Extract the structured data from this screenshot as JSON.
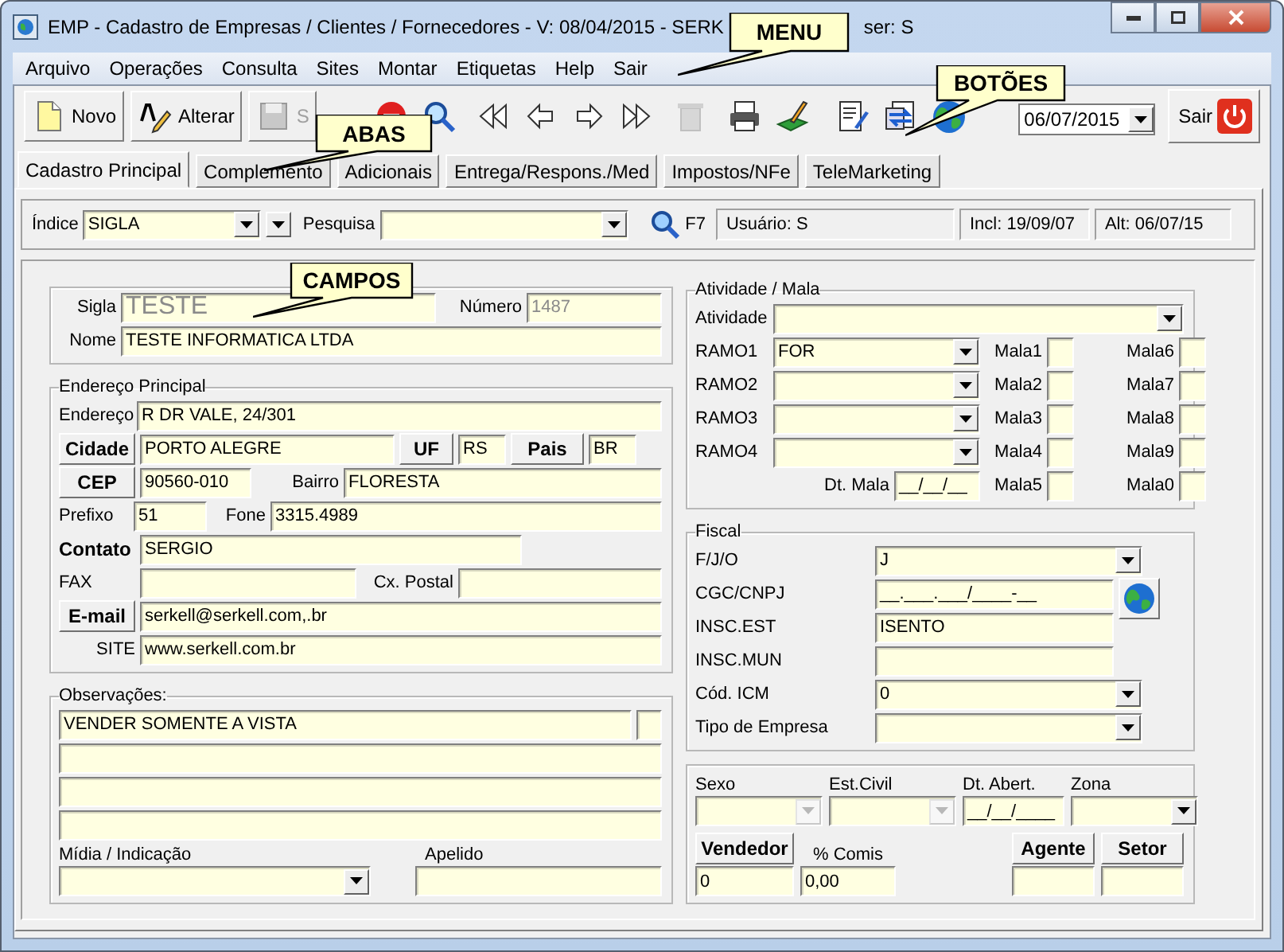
{
  "window": {
    "title": "EMP - Cadastro de Empresas / Clientes / Fornecedores - V: 08/04/2015 - SERK",
    "title_tail": "ser: S"
  },
  "menu": [
    "Arquivo",
    "Operações",
    "Consulta",
    "Sites",
    "Montar",
    "Etiquetas",
    "Help",
    "Sair"
  ],
  "toolbar": [
    {
      "kind": "new",
      "label": "Novo",
      "disabled": false
    },
    {
      "kind": "edit",
      "label": "Alterar",
      "disabled": false
    },
    {
      "kind": "save",
      "label": "S",
      "disabled": true
    },
    {
      "kind": "stop",
      "disabled": false
    },
    {
      "kind": "search",
      "disabled": false
    },
    {
      "kind": "first",
      "disabled": false
    },
    {
      "kind": "prev",
      "disabled": false
    },
    {
      "kind": "next",
      "disabled": false
    },
    {
      "kind": "last",
      "disabled": false
    },
    {
      "kind": "delete",
      "disabled": true
    },
    {
      "kind": "print",
      "disabled": false
    },
    {
      "kind": "sign",
      "disabled": false
    },
    {
      "kind": "notes",
      "disabled": false
    },
    {
      "kind": "transfer",
      "disabled": false
    },
    {
      "kind": "globe",
      "disabled": false
    }
  ],
  "date": "06/07/2015",
  "exit_label": "Sair",
  "tabs": [
    {
      "label": "Cadastro Principal",
      "selected": true
    },
    {
      "label": "Complemento",
      "selected": false
    },
    {
      "label": "Adicionais",
      "selected": false
    },
    {
      "label": "Entrega/Respons./Med",
      "selected": false
    },
    {
      "label": "Impostos/NFe",
      "selected": false
    },
    {
      "label": "TeleMarketing",
      "selected": false
    }
  ],
  "search": {
    "index_label": "Índice",
    "index_value": "SIGLA",
    "search_label": "Pesquisa",
    "key_hint": "F7",
    "user": "Usuário: S",
    "created": "Incl: 19/09/07",
    "changed": "Alt: 06/07/15"
  },
  "identification": {
    "lines": [
      {
        "items": [
          {
            "kind": "label",
            "text": "Sigla"
          },
          {
            "kind": "field",
            "text": "TESTE",
            "readonly": true
          },
          {
            "kind": "label",
            "text": "Número"
          },
          {
            "kind": "field",
            "text": "1487",
            "readonly": true
          }
        ]
      },
      {
        "items": [
          {
            "kind": "label",
            "text": "Nome"
          },
          {
            "kind": "field",
            "text": "TESTE INFORMATICA LTDA",
            "readonly": false
          }
        ]
      }
    ]
  },
  "address": {
    "title": "Endereço Principal",
    "lines": [
      {
        "items": [
          {
            "kind": "label",
            "text": "Endereço"
          },
          {
            "kind": "field",
            "text": "R DR VALE, 24/301"
          }
        ]
      },
      {
        "items": [
          {
            "kind": "button",
            "text": "Cidade"
          },
          {
            "kind": "field",
            "text": "PORTO ALEGRE"
          },
          {
            "kind": "button",
            "text": "UF"
          },
          {
            "kind": "field",
            "text": "RS"
          },
          {
            "kind": "button",
            "text": "Pais"
          },
          {
            "kind": "field",
            "text": "BR"
          }
        ]
      },
      {
        "items": [
          {
            "kind": "button",
            "text": "CEP"
          },
          {
            "kind": "field",
            "text": "90560-010"
          },
          {
            "kind": "label",
            "text": "Bairro"
          },
          {
            "kind": "field",
            "text": "FLORESTA"
          }
        ]
      },
      {
        "items": [
          {
            "kind": "label",
            "text": "Prefixo"
          },
          {
            "kind": "field",
            "text": "51"
          },
          {
            "kind": "label",
            "text": "Fone"
          },
          {
            "kind": "field",
            "text": "3315.4989"
          }
        ]
      },
      {
        "items": [
          {
            "kind": "strong",
            "text": "Contato"
          },
          {
            "kind": "field",
            "text": "SERGIO"
          }
        ]
      },
      {
        "items": [
          {
            "kind": "label",
            "text": "FAX"
          },
          {
            "kind": "field"
          },
          {
            "kind": "label",
            "text": "Cx. Postal"
          },
          {
            "kind": "field"
          }
        ]
      },
      {
        "items": [
          {
            "kind": "button",
            "text": "E-mail"
          },
          {
            "kind": "field",
            "text": "serkell@serkell.com,.br"
          }
        ]
      },
      {
        "items": [
          {
            "kind": "label",
            "text": "SITE"
          },
          {
            "kind": "field",
            "text": "www.serkell.com.br"
          }
        ]
      }
    ]
  },
  "notes": {
    "title": "Observações:",
    "lines": [
      "VENDER SOMENTE A VISTA"
    ],
    "media_label": "Mídia / Indicação",
    "nickname_label": "Apelido"
  },
  "activity": {
    "title": "Atividade / Mala",
    "lines": [
      {
        "items": [
          {
            "kind": "label",
            "text": "Atividade"
          },
          {
            "kind": "combo"
          }
        ]
      },
      {
        "items": [
          {
            "kind": "label",
            "text": "RAMO1"
          },
          {
            "kind": "combo",
            "text": "FOR"
          },
          {
            "kind": "label",
            "text": "Mala1"
          },
          {
            "kind": "field"
          },
          {
            "kind": "label",
            "text": "Mala6"
          },
          {
            "kind": "field"
          }
        ]
      },
      {
        "items": [
          {
            "kind": "label",
            "text": "RAMO2"
          },
          {
            "kind": "combo"
          },
          {
            "kind": "label",
            "text": "Mala2"
          },
          {
            "kind": "field"
          },
          {
            "kind": "label",
            "text": "Mala7"
          },
          {
            "kind": "field"
          }
        ]
      },
      {
        "items": [
          {
            "kind": "label",
            "text": "RAMO3"
          },
          {
            "kind": "combo"
          },
          {
            "kind": "label",
            "text": "Mala3"
          },
          {
            "kind": "field"
          },
          {
            "kind": "label",
            "text": "Mala8"
          },
          {
            "kind": "field"
          }
        ]
      },
      {
        "items": [
          {
            "kind": "label",
            "text": "RAMO4"
          },
          {
            "kind": "combo"
          },
          {
            "kind": "label",
            "text": "Mala4"
          },
          {
            "kind": "field"
          },
          {
            "kind": "label",
            "text": "Mala9"
          },
          {
            "kind": "field"
          }
        ]
      },
      {
        "items": [
          {
            "kind": "label",
            "text": "Dt. Mala"
          },
          {
            "kind": "field",
            "text": "__/__/__"
          },
          {
            "kind": "label",
            "text": "Mala5"
          },
          {
            "kind": "field"
          },
          {
            "kind": "label",
            "text": "Mala0"
          },
          {
            "kind": "field"
          }
        ]
      }
    ]
  },
  "fiscal": {
    "title": "Fiscal",
    "lines": [
      {
        "items": [
          {
            "kind": "label",
            "text": "F/J/O"
          },
          {
            "kind": "combo",
            "text": "J"
          }
        ]
      },
      {
        "items": [
          {
            "kind": "label",
            "text": "CGC/CNPJ"
          },
          {
            "kind": "field",
            "text": "__.___.___/____-__"
          },
          {
            "kind": "globe"
          }
        ]
      },
      {
        "items": [
          {
            "kind": "label",
            "text": "INSC.EST"
          },
          {
            "kind": "field",
            "text": "ISENTO"
          }
        ]
      },
      {
        "items": [
          {
            "kind": "label",
            "text": "INSC.MUN"
          },
          {
            "kind": "field"
          }
        ]
      },
      {
        "items": [
          {
            "kind": "label",
            "text": "Cód. ICM"
          },
          {
            "kind": "combo",
            "text": "0"
          }
        ]
      },
      {
        "items": [
          {
            "kind": "label",
            "text": "Tipo de Empresa"
          },
          {
            "kind": "combo"
          }
        ]
      }
    ]
  },
  "commercial": {
    "blocks": [
      {
        "headers": [
          {
            "kind": "label",
            "text": "Sexo"
          },
          {
            "kind": "label",
            "text": "Est.Civil"
          },
          {
            "kind": "label",
            "text": "Dt. Abert."
          },
          {
            "kind": "label",
            "text": "Zona"
          }
        ],
        "controls": [
          {
            "kind": "combo",
            "disabled": true
          },
          {
            "kind": "combo",
            "disabled": true
          },
          {
            "kind": "field",
            "text": "__/__/____"
          },
          {
            "kind": "combo",
            "disabled": false
          }
        ]
      },
      {
        "headers": [
          {
            "kind": "button",
            "text": "Vendedor"
          },
          {
            "kind": "label",
            "text": "% Comis"
          },
          {
            "kind": "button",
            "text": "Agente"
          },
          {
            "kind": "button",
            "text": "Setor"
          }
        ],
        "controls": [
          {
            "kind": "field",
            "text": "0"
          },
          {
            "kind": "field",
            "text": "0,00"
          },
          {
            "kind": "field"
          },
          {
            "kind": "field"
          }
        ]
      }
    ]
  },
  "callouts": [
    "MENU",
    "BOTÕES",
    "ABAS",
    "CAMPOS"
  ]
}
